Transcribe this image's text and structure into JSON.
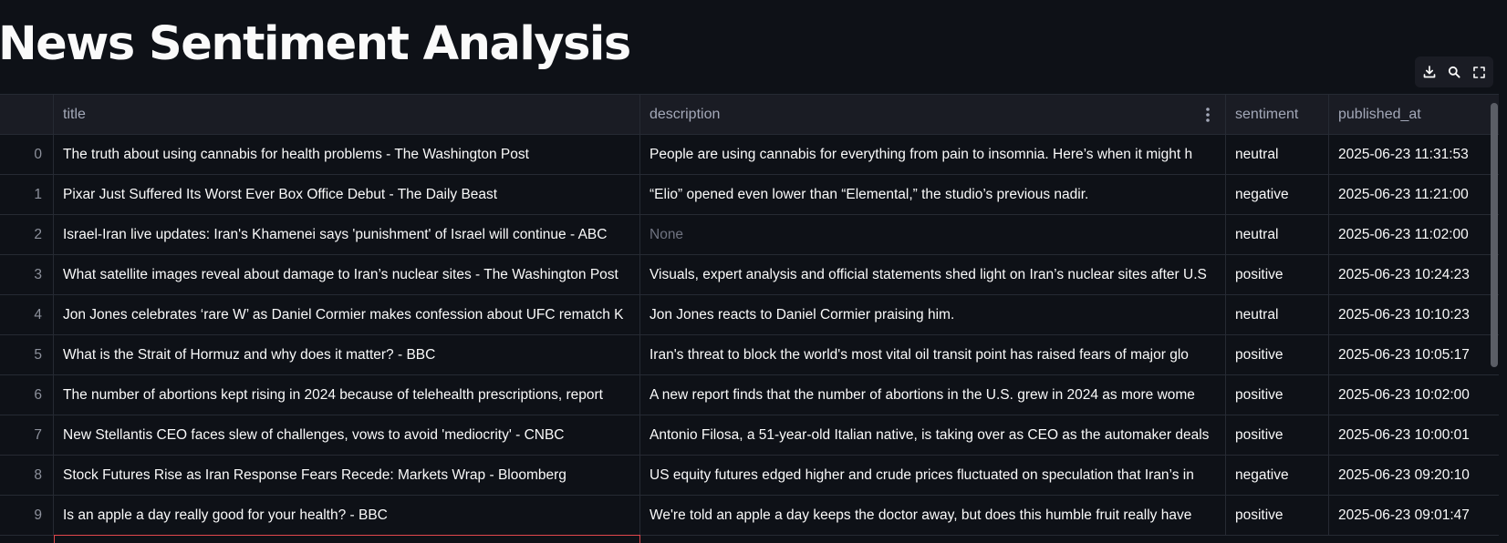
{
  "page": {
    "title": "News Sentiment Analysis"
  },
  "toolbar": {
    "download_icon": "download-icon",
    "search_icon": "search-icon",
    "fullscreen_icon": "fullscreen-icon"
  },
  "table": {
    "columns": {
      "index": "",
      "title": "title",
      "description": "description",
      "sentiment": "sentiment",
      "published_at": "published_at"
    },
    "rows": [
      {
        "index": "0",
        "title": "The truth about using cannabis for health problems - The Washington Post",
        "description": "People are using cannabis for everything from pain to insomnia. Here’s when it might h",
        "sentiment": "neutral",
        "published_at": "2025-06-23 11:31:53"
      },
      {
        "index": "1",
        "title": "Pixar Just Suffered Its Worst Ever Box Office Debut - The Daily Beast",
        "description": "“Elio” opened even lower than “Elemental,” the studio’s previous nadir.",
        "sentiment": "negative",
        "published_at": "2025-06-23 11:21:00"
      },
      {
        "index": "2",
        "title": "Israel-Iran live updates: Iran's Khamenei says 'punishment' of Israel will continue - ABC",
        "description": "None",
        "sentiment": "neutral",
        "published_at": "2025-06-23 11:02:00"
      },
      {
        "index": "3",
        "title": "What satellite images reveal about damage to Iran’s nuclear sites - The Washington Post",
        "description": "Visuals, expert analysis and official statements shed light on Iran’s nuclear sites after U.S",
        "sentiment": "positive",
        "published_at": "2025-06-23 10:24:23"
      },
      {
        "index": "4",
        "title": "Jon Jones celebrates ‘rare W’ as Daniel Cormier makes confession about UFC rematch K",
        "description": "Jon Jones reacts to Daniel Cormier praising him.",
        "sentiment": "neutral",
        "published_at": "2025-06-23 10:10:23"
      },
      {
        "index": "5",
        "title": "What is the Strait of Hormuz and why does it matter? - BBC",
        "description": "Iran's threat to block the world's most vital oil transit point has raised fears of major glo",
        "sentiment": "positive",
        "published_at": "2025-06-23 10:05:17"
      },
      {
        "index": "6",
        "title": "The number of abortions kept rising in 2024 because of telehealth prescriptions, report",
        "description": "A new report finds that the number of abortions in the U.S. grew in 2024 as more wome",
        "sentiment": "positive",
        "published_at": "2025-06-23 10:02:00"
      },
      {
        "index": "7",
        "title": "New Stellantis CEO faces slew of challenges, vows to avoid 'mediocrity' - CNBC",
        "description": "Antonio Filosa, a 51-year-old Italian native, is taking over as CEO as the automaker deals",
        "sentiment": "positive",
        "published_at": "2025-06-23 10:00:01"
      },
      {
        "index": "8",
        "title": "Stock Futures Rise as Iran Response Fears Recede: Markets Wrap - Bloomberg",
        "description": "US equity futures edged higher and crude prices fluctuated on speculation that Iran’s in",
        "sentiment": "negative",
        "published_at": "2025-06-23 09:20:10"
      },
      {
        "index": "9",
        "title": "Is an apple a day really good for your health? - BBC",
        "description": "We're told an apple a day keeps the doctor away, but does this humble fruit really have",
        "sentiment": "positive",
        "published_at": "2025-06-23 09:01:47"
      }
    ]
  },
  "colors": {
    "background": "#0e1117",
    "header_bg": "#1a1c24",
    "grid_line": "#262a33",
    "selection_border": "#e0474c",
    "none_text": "#6f7380"
  }
}
